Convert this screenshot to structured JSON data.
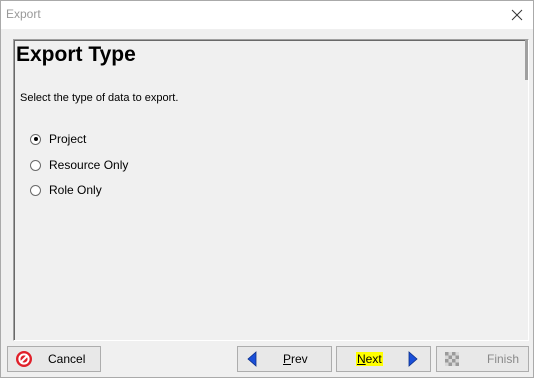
{
  "window": {
    "title": "Export",
    "close_icon": "close-icon"
  },
  "panel": {
    "heading": "Export Type",
    "instruction": "Select the type of data to export.",
    "options": [
      {
        "label": "Project",
        "checked": true
      },
      {
        "label": "Resource Only",
        "checked": false
      },
      {
        "label": "Role Only",
        "checked": false
      }
    ]
  },
  "buttons": {
    "cancel": {
      "label": "Cancel",
      "icon": "no-entry-icon"
    },
    "prev": {
      "label_mnemonic": "P",
      "label_rest": "rev",
      "icon": "arrow-left-icon"
    },
    "next": {
      "label_mnemonic": "N",
      "label_rest": "ext",
      "icon": "arrow-right-icon",
      "highlight": "#ffff00"
    },
    "finish": {
      "label": "Finish",
      "icon": "checkered-flag-icon",
      "disabled": true
    }
  },
  "colors": {
    "cancel_icon": "#e0202a",
    "arrow": "#1a4fd8"
  }
}
